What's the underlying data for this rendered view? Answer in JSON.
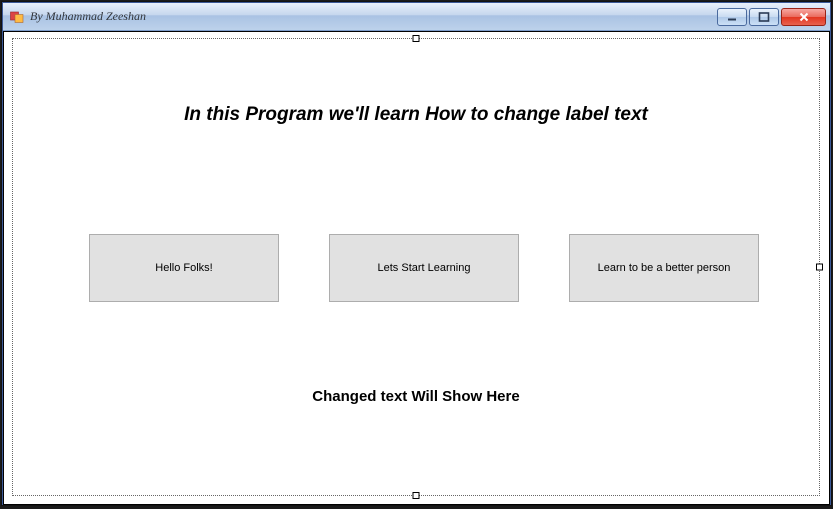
{
  "window": {
    "title": "By Muhammad Zeeshan"
  },
  "heading": "In this Program we'll learn How to change label text",
  "buttons": {
    "b1": "Hello Folks!",
    "b2": "Lets Start Learning",
    "b3": "Learn to be a better person"
  },
  "result_label": "Changed text Will Show Here"
}
